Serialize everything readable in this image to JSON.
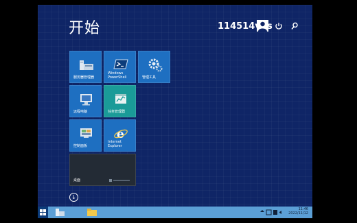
{
  "start": {
    "title": "开始"
  },
  "user": {
    "name": "114514vps"
  },
  "icons": {
    "user": "user-avatar-icon",
    "power": "power-icon",
    "search": "search-icon"
  },
  "tiles": [
    {
      "label": "服务器管理器",
      "icon": "server-manager-icon",
      "color": "#1e6fc1"
    },
    {
      "label": "Windows\nPowerShell",
      "icon": "powershell-icon",
      "color": "#1e6fc1"
    },
    {
      "label": "管理工具",
      "icon": "admin-tools-icon",
      "color": "#1e6fc1"
    },
    {
      "label": "远程电脑",
      "icon": "remote-desktop-icon",
      "color": "#1e6fc1"
    },
    {
      "label": "任务管理器",
      "icon": "task-manager-icon",
      "color": "#1a9b98"
    },
    {
      "label": "控制面板",
      "icon": "control-panel-icon",
      "color": "#1e6fc1"
    },
    {
      "label": "Internet\nExplorer",
      "icon": "internet-explorer-icon",
      "color": "#1e6fc1"
    },
    {
      "label": "桌面",
      "icon": "desktop-icon",
      "color": "#232b35"
    }
  ],
  "taskbar": {
    "time": "11:46",
    "date": "2022/11/12"
  },
  "colors": {
    "background": "#0f2566",
    "taskbar": "#5b9fd6",
    "tile_blue": "#1e6fc1",
    "tile_teal": "#1a9b98"
  }
}
